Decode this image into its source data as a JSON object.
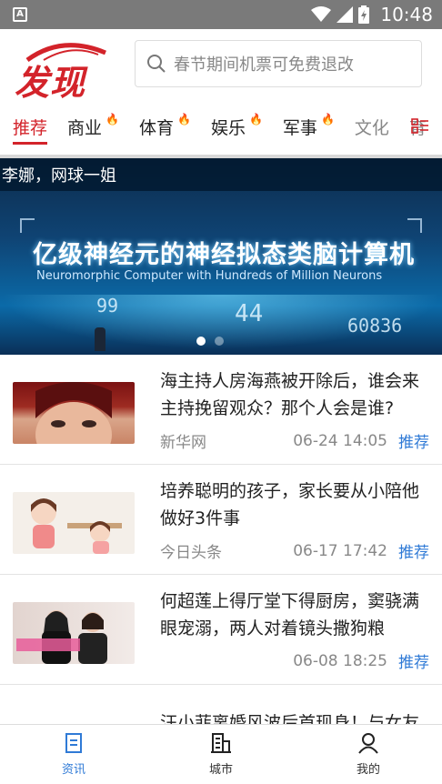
{
  "status_bar": {
    "notification_icon": "A",
    "time": "10:48"
  },
  "header": {
    "logo_text": "发现",
    "search_placeholder": "春节期间机票可免费退改"
  },
  "tabs": [
    {
      "label": "推荐",
      "active": true,
      "hot": false
    },
    {
      "label": "商业",
      "active": false,
      "hot": true
    },
    {
      "label": "体育",
      "active": false,
      "hot": true
    },
    {
      "label": "娱乐",
      "active": false,
      "hot": true
    },
    {
      "label": "军事",
      "active": false,
      "hot": true
    },
    {
      "label": "文化",
      "active": false,
      "hot": false
    },
    {
      "label": "育",
      "active": false,
      "hot": false
    }
  ],
  "banner": {
    "title": "李娜，网球一姐",
    "main_text": "亿级神经元的神经拟态类脑计算机",
    "sub_text": "Neuromorphic Computer with Hundreds of Million Neurons",
    "numbers": [
      "99",
      "44",
      "60836"
    ],
    "dots_count": 2,
    "active_dot": 0
  },
  "news": [
    {
      "title": "海主持人房海燕被开除后，谁会来主持挽留观众？那个人会是谁?",
      "source": "新华网",
      "time": "06-24 14:05",
      "tag": "推荐"
    },
    {
      "title": "培养聪明的孩子，家长要从小陪他做好3件事",
      "source": "今日头条",
      "time": "06-17 17:42",
      "tag": "推荐"
    },
    {
      "title": "何超莲上得厅堂下得厨房，窦骁满眼宠溺，两人对着镜头撒狗粮",
      "source": "",
      "time": "06-08 18:25",
      "tag": "推荐"
    }
  ],
  "partial_news_title": "汪小菲离婚风波后首现身！与女友",
  "bottom_nav": [
    {
      "label": "资讯",
      "icon": "news-icon",
      "active": true
    },
    {
      "label": "城市",
      "icon": "city-building-icon",
      "active": false
    },
    {
      "label": "我的",
      "icon": "person-icon",
      "active": false
    }
  ],
  "colors": {
    "brand": "#d3232a",
    "link": "#2f7ad6",
    "hot": "#f59a23"
  }
}
